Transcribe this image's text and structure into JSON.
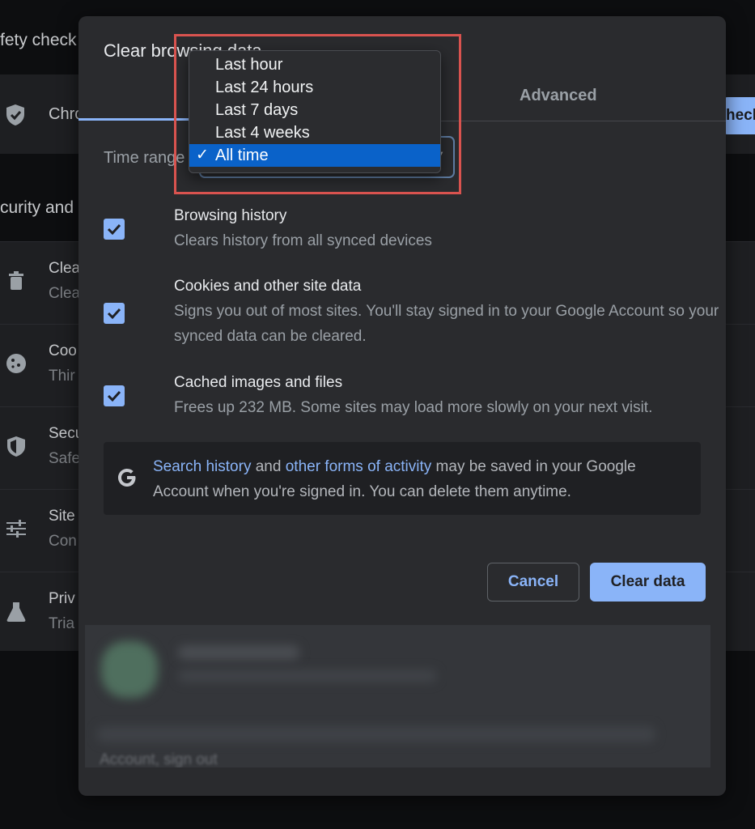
{
  "background": {
    "safety_heading": "fety check",
    "safety_row_text": "Chro",
    "check_button": "heck",
    "privacy_heading": "curity and",
    "rows": [
      {
        "icon": "trash-icon",
        "title": "Clea",
        "subtitle": "Clea"
      },
      {
        "icon": "cookie-icon",
        "title": "Coo",
        "subtitle": "Thir"
      },
      {
        "icon": "shield-icon",
        "title": "Secu",
        "subtitle": "Safe"
      },
      {
        "icon": "sliders-icon",
        "title": "Site",
        "subtitle": "Con"
      },
      {
        "icon": "flask-icon",
        "title": "Priv",
        "subtitle": "Tria"
      }
    ]
  },
  "dialog": {
    "title": "Clear browsing data",
    "tab_advanced": "Advanced",
    "time_range_label": "Time range",
    "options": [
      {
        "title": "Browsing history",
        "description": "Clears history from all synced devices",
        "checked": true
      },
      {
        "title": "Cookies and other site data",
        "description": "Signs you out of most sites. You'll stay signed in to your Google Account so your synced data can be cleared.",
        "checked": true
      },
      {
        "title": "Cached images and files",
        "description": "Frees up 232 MB. Some sites may load more slowly on your next visit.",
        "checked": true
      }
    ],
    "info": {
      "link1": "Search history",
      "text1": " and ",
      "link2": "other forms of activity",
      "text2": " may be saved in your Google Account when you're signed in. You can delete them anytime."
    },
    "cancel_label": "Cancel",
    "clear_label": "Clear data",
    "footer_text": "Account, sign out"
  },
  "dropdown": {
    "items": [
      "Last hour",
      "Last 24 hours",
      "Last 7 days",
      "Last 4 weeks",
      "All time"
    ],
    "selected": "All time",
    "check_glyph": "✓"
  },
  "colors": {
    "accent": "#8ab4f8",
    "selection": "#0a62c9",
    "highlight_border": "#d9534f"
  }
}
